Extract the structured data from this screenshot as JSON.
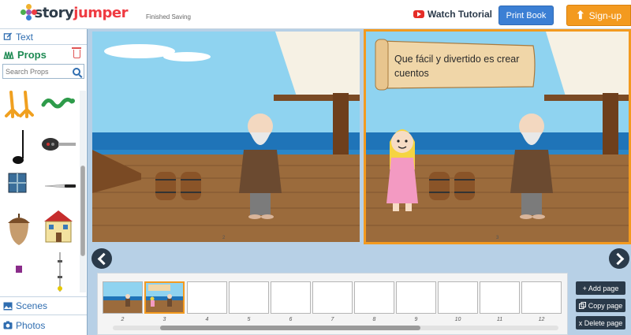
{
  "header": {
    "logo_text_story": "story",
    "logo_text_jumper": "jumper",
    "save_status": "Finished Saving",
    "watch_tutorial_label": "Watch Tutorial",
    "print_book_label": "Print Book",
    "signup_label": "Sign-up",
    "colors": {
      "print": "#3b7fd4",
      "signup": "#f39a1f",
      "youtube": "#e52d27"
    }
  },
  "left_panel": {
    "text_label": "Text",
    "props_label": "Props",
    "search_placeholder": "Search Props",
    "scenes_label": "Scenes",
    "photos_label": "Photos",
    "props": [
      "chicken-feet",
      "green-snake",
      "music-note",
      "car-key",
      "window",
      "knife",
      "acorn",
      "house",
      "small-square",
      "pole"
    ]
  },
  "book": {
    "speech_text": "Que fácil y divertido es crear cuentos",
    "left_page_number": "2",
    "right_page_number": "3"
  },
  "filmstrip": {
    "pages": [
      "2",
      "3",
      "4",
      "5",
      "6",
      "7",
      "8",
      "9",
      "10",
      "11",
      "12"
    ],
    "active_page": "3"
  },
  "actions": {
    "add_page": "+ Add page",
    "copy_page": "Copy page",
    "delete_page": "x Delete page"
  }
}
